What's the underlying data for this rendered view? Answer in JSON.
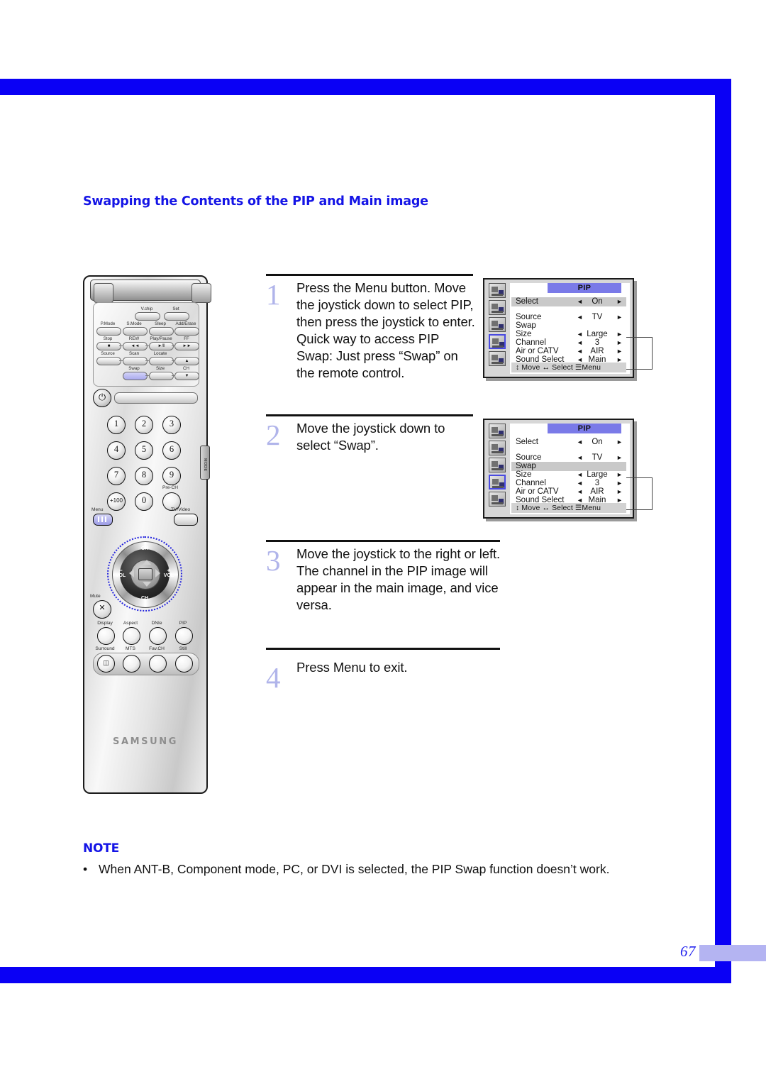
{
  "page": {
    "number": "67",
    "section_title": "Swapping the Contents of the PIP and Main image",
    "note_title": "NOTE",
    "note_bullet": "When ANT-B, Component mode, PC, or DVI is selected, the PIP Swap function doesn’t work."
  },
  "steps": [
    {
      "number": "1",
      "text": "Press the Menu button. Move the joystick down to select PIP, then press the joystick to enter. Quick way to access PIP Swap:  Just press “Swap” on the remote control."
    },
    {
      "number": "2",
      "text": "Move the joystick down to select “Swap”."
    },
    {
      "number": "3",
      "text": "Move the joystick to the right or left. The channel in the PIP image will appear in the main image, and vice versa."
    },
    {
      "number": "4",
      "text": "Press Menu to exit."
    }
  ],
  "osd_menus": [
    {
      "title": "PIP",
      "highlighted_row": "Select",
      "rows": [
        {
          "label": "Select",
          "value": "On",
          "left_arrow": "◄",
          "right_arrow": "►"
        },
        {
          "label": "Source",
          "value": "TV",
          "left_arrow": "◄",
          "right_arrow": "►"
        },
        {
          "label": "Swap",
          "value": "",
          "left_arrow": "",
          "right_arrow": ""
        },
        {
          "label": "Size",
          "value": "Large",
          "left_arrow": "◄",
          "right_arrow": "►"
        },
        {
          "label": "Channel",
          "value": "3",
          "left_arrow": "◄",
          "right_arrow": "►"
        },
        {
          "label": "Air or CATV",
          "value": "AIR",
          "left_arrow": "◄",
          "right_arrow": "►"
        },
        {
          "label": "Sound Select",
          "value": "Main",
          "left_arrow": "◄",
          "right_arrow": "►"
        }
      ],
      "footer": "↕ Move  ↔ Select   ☰Menu"
    },
    {
      "title": "PIP",
      "highlighted_row": "Swap",
      "rows": [
        {
          "label": "Select",
          "value": "On",
          "left_arrow": "◄",
          "right_arrow": "►"
        },
        {
          "label": "Source",
          "value": "TV",
          "left_arrow": "◄",
          "right_arrow": "►"
        },
        {
          "label": "Swap",
          "value": "",
          "left_arrow": "",
          "right_arrow": ""
        },
        {
          "label": "Size",
          "value": "Large",
          "left_arrow": "◄",
          "right_arrow": "►"
        },
        {
          "label": "Channel",
          "value": "3",
          "left_arrow": "◄",
          "right_arrow": "►"
        },
        {
          "label": "Air or CATV",
          "value": "AIR",
          "left_arrow": "◄",
          "right_arrow": "►"
        },
        {
          "label": "Sound Select",
          "value": "Main",
          "left_arrow": "◄",
          "right_arrow": "►"
        }
      ],
      "footer": "↕ Move  ↔ Select   ☰Menu"
    }
  ],
  "remote": {
    "brand": "SAMSUNG",
    "mode_switch_label": "MODE",
    "power_icon": "⏻",
    "mute_label": "Mute",
    "mute_icon": "✕",
    "menu_label": "Menu",
    "tv_video_label": "TV/Video",
    "pre_ch_label": "Pre-CH",
    "top_buttons": [
      {
        "label": "V.chip"
      },
      {
        "label": "Set"
      },
      {
        "label": "P.Mode"
      },
      {
        "label": "S.Mode"
      },
      {
        "label": "Sleep"
      },
      {
        "label": "Add/Erase"
      },
      {
        "label": "Stop",
        "glyph": "■"
      },
      {
        "label": "REW",
        "glyph": "◄◄"
      },
      {
        "label": "Play/Pause",
        "glyph": "►/‖"
      },
      {
        "label": "FF",
        "glyph": "►►"
      },
      {
        "label": "Source"
      },
      {
        "label": "Scan"
      },
      {
        "label": "Locate"
      },
      {
        "label": "CH up",
        "glyph": "▲"
      },
      {
        "label": "Swap",
        "highlight": true
      },
      {
        "label": "Size"
      },
      {
        "label": "CH",
        "glyph": "▼"
      }
    ],
    "keypad": [
      "1",
      "2",
      "3",
      "4",
      "5",
      "6",
      "7",
      "8",
      "9",
      "+100",
      "0"
    ],
    "joystick": {
      "ch_up": "CH",
      "ch_up_arrow": "⌃",
      "ch_down": "CH",
      "ch_down_arrow": "⌄",
      "vol_down": "VOL",
      "vol_down_sign": "−",
      "vol_up": "VOL",
      "vol_up_sign": "+"
    },
    "function_row_1": [
      "Display",
      "Aspect",
      "DNIe",
      "PIP"
    ],
    "function_row_2": [
      "Surround",
      "MTS",
      "Fav.CH",
      "Still"
    ]
  },
  "colors": {
    "frame_blue": "#0a00f5",
    "heading_blue": "#1414e6",
    "step_number": "#b0b4ea",
    "osd_title_bar": "#7a7ae8",
    "page_bar": "#b4b4f2"
  }
}
